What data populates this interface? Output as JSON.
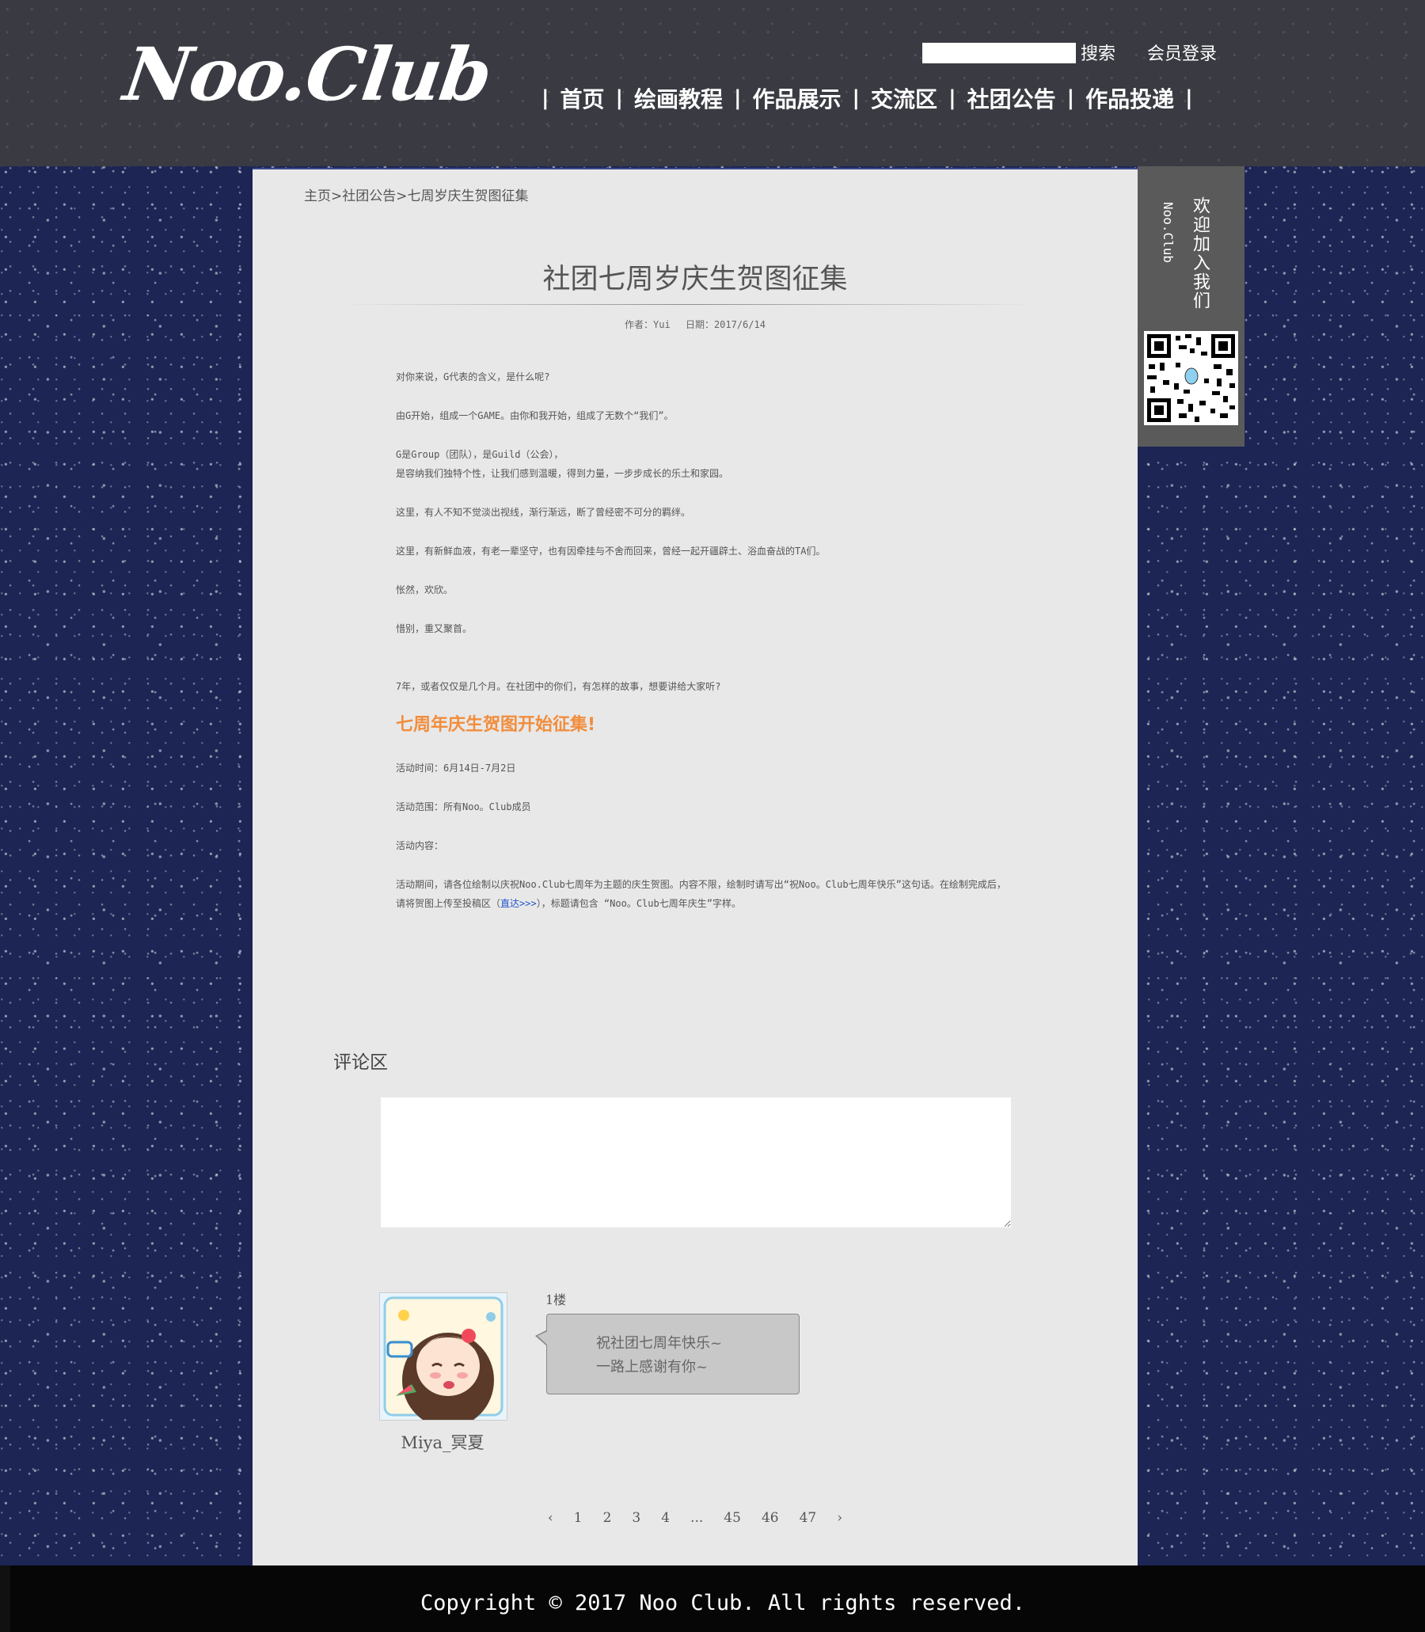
{
  "header": {
    "logo": "Noo.Club",
    "search_label": "搜索",
    "login_label": "会员登录",
    "nav": [
      "首页",
      "绘画教程",
      "作品展示",
      "交流区",
      "社团公告",
      "作品投递"
    ],
    "nav_separator": "|"
  },
  "breadcrumb": {
    "home": "主页",
    "section": "社团公告",
    "current": "七周岁庆生贺图征集",
    "sep": ">"
  },
  "article": {
    "title": "社团七周岁庆生贺图征集",
    "author": "作者：Yui",
    "date": "日期：2017/6/14",
    "paragraphs": [
      "对你来说，G代表的含义，是什么呢?",
      "由G开始，组成一个GAME。由你和我开始，组成了无数个“我们”。",
      "G是Group（团队），是Guild（公会），",
      "是容纳我们独特个性，让我们感到温暖，得到力量，一步步成长的乐土和家园。",
      "这里，有人不知不觉淡出视线，渐行渐远，断了曾经密不可分的羁绊。",
      "这里，有新鲜血液，有老一辈坚守，也有因牵挂与不舍而回来，曾经一起开疆辟土、浴血奋战的TA们。",
      "怅然，欢欣。",
      "惜别，重又聚首。",
      "7年，或者仅仅是几个月。在社团中的你们，有怎样的故事，想要讲给大家听?"
    ],
    "highlight": "七周年庆生贺图开始征集!",
    "activity_time": "活动时间：6月14日-7月2日",
    "activity_scope": "活动范围：所有Noo。Club成员",
    "activity_content_label": "活动内容：",
    "detail_line1": "活动期间，请各位绘制以庆祝Noo.Club七周年为主题的庆生贺图。内容不限，绘制时请写出“祝Noo。Club七周年快乐”这句话。在绘制完成后，",
    "detail_line2_prefix": "请将贺图上传至投稿区（",
    "detail_link": "直达>>>",
    "detail_line2_suffix": "），标题请包含 “Noo。Club七周年庆生”字样。"
  },
  "comments": {
    "title": "评论区",
    "items": [
      {
        "floor": "1楼",
        "user": "Miya_冥夏",
        "lines": [
          "祝社团七周年快乐~",
          "一路上感谢有你~"
        ]
      }
    ]
  },
  "pagination": {
    "prev": "‹",
    "pages": [
      "1",
      "2",
      "3",
      "4",
      "...",
      "45",
      "46",
      "47"
    ],
    "next": "›"
  },
  "side": {
    "welcome": "欢迎加入我们",
    "brand": "Noo.Club"
  },
  "footer": {
    "copyright": "Copyright © 2017 Noo Club. All rights reserved."
  }
}
